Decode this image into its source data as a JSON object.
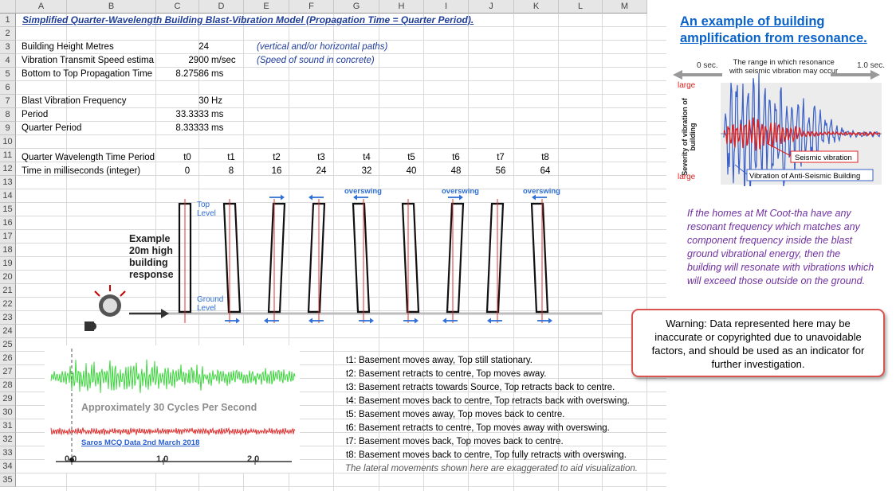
{
  "columns": [
    "A",
    "B",
    "C",
    "D",
    "E",
    "F",
    "G",
    "H",
    "I",
    "J",
    "K",
    "L",
    "M"
  ],
  "rows": [
    "1",
    "2",
    "3",
    "4",
    "5",
    "6",
    "7",
    "8",
    "9",
    "10",
    "11",
    "12",
    "13",
    "14",
    "15",
    "16",
    "17",
    "18",
    "19",
    "20",
    "21",
    "22",
    "23",
    "24",
    "25",
    "26",
    "27",
    "28",
    "29",
    "30",
    "31",
    "32",
    "33",
    "34",
    "35"
  ],
  "title": "Simplified Quarter-Wavelength Building Blast-Vibration Model (Propagation Time = Quarter Period).",
  "params": [
    {
      "label": "Building Height Metres",
      "value": "24",
      "unit": "",
      "note": "(vertical and/or horizontal paths)"
    },
    {
      "label": "Vibration Transmit Speed estima",
      "value": "2900",
      "unit": "m/sec",
      "note": "(Speed of sound in concrete)"
    },
    {
      "label": "Bottom to Top Propagation Time",
      "value": "8.27586",
      "unit": "ms",
      "note": ""
    },
    {
      "label": "Blast Vibration Frequency",
      "value": "30",
      "unit": "Hz",
      "note": ""
    },
    {
      "label": "Period",
      "value": "33.3333",
      "unit": "ms",
      "note": ""
    },
    {
      "label": "Quarter Period",
      "value": "8.33333",
      "unit": "ms",
      "note": ""
    }
  ],
  "time_table": {
    "row1_label": "Quarter Wavelength Time Period",
    "row2_label": "Time in milliseconds (integer)",
    "periods": [
      "t0",
      "t1",
      "t2",
      "t3",
      "t4",
      "t5",
      "t6",
      "t7",
      "t8"
    ],
    "times": [
      "0",
      "8",
      "16",
      "24",
      "32",
      "40",
      "48",
      "56",
      "64"
    ]
  },
  "diagram": {
    "example_label": "Example\n20m high\nbuilding\nresponse",
    "top_level": "Top\nLevel",
    "ground_level": "Ground\nLevel",
    "overswing": "overswing"
  },
  "seismo": {
    "caption": "Approximately 30 Cycles Per Second",
    "source": "Saros MCQ Data 2nd March 2018",
    "ticks": [
      "0.0",
      "1.0",
      "2.0"
    ]
  },
  "notes": [
    "t1: Basement moves away, Top still stationary.",
    "t2: Basement retracts to centre, Top moves away.",
    "t3: Basement retracts towards Source, Top retracts back to centre.",
    "t4: Basement moves back to centre, Top retracts back with overswing.",
    "t5: Basement moves away, Top moves back to centre.",
    "t6: Basement retracts to centre, Top moves away with overswing.",
    "t7: Basement moves back, Top moves back to centre.",
    "t8: Basement moves back to centre, Top fully retracts with overswing."
  ],
  "exaggeration_note": "The lateral movements shown here are exaggerated to aid visualization.",
  "right_panel": {
    "heading_line1": "An example of building ",
    "heading_line2": "amplification from resonance.",
    "chart_top_left": "0 sec.",
    "chart_top_mid": "The range in which resonance\nwith seismic vibration may occur",
    "chart_top_right": "1.0 sec.",
    "chart_large_top": "large",
    "chart_large_bottom": "large",
    "chart_ylabel": "Severity of vibration of building",
    "legend_seismic": "Seismic vibration",
    "legend_building": "Vibration of Anti-Seismic Building",
    "paragraph": "If the homes at Mt Coot-tha have any resonant frequency which matches any component frequency inside the blast ground vibrational energy, then the building will resonate with vibrations which will exceed those outside on the ground.",
    "warning": "Warning: Data represented here may be inaccurate or copyrighted due to unavoidable factors, and should be used as an indicator for further investigation."
  }
}
